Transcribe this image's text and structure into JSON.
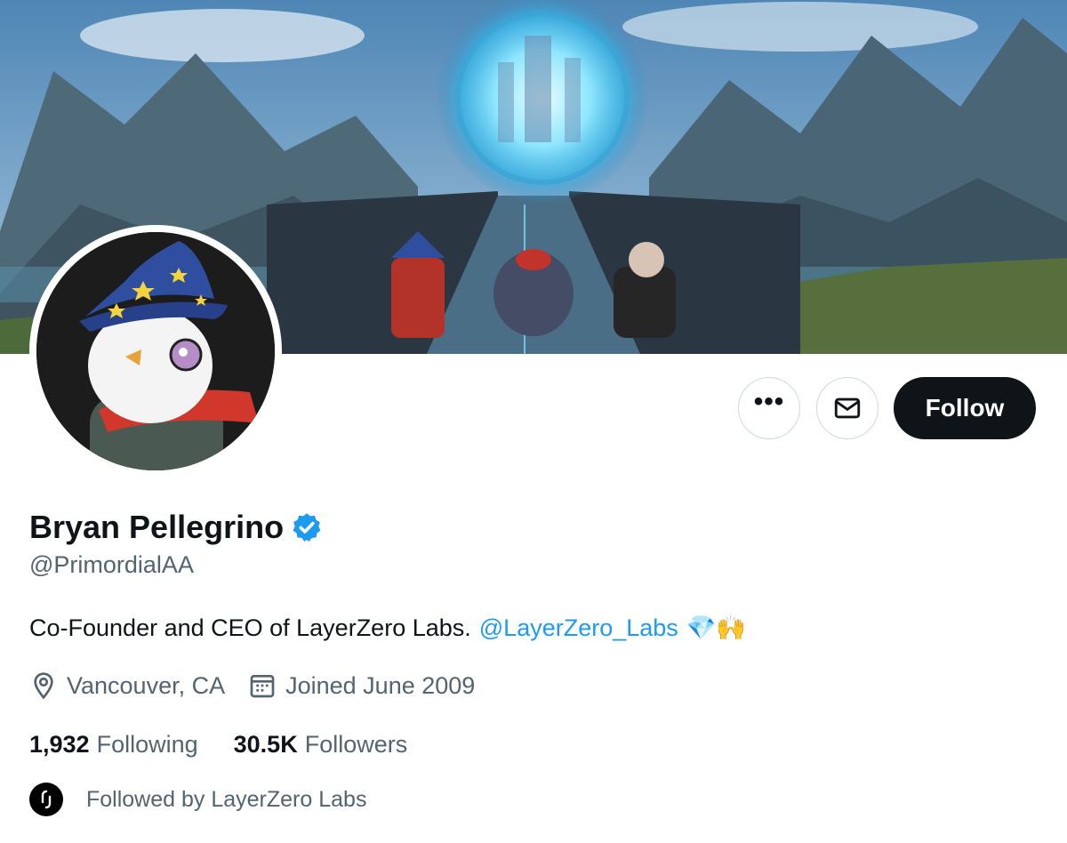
{
  "profile": {
    "display_name": "Bryan Pellegrino",
    "handle": "@PrimordialAA",
    "verified": true,
    "bio_text": "Co-Founder and CEO of LayerZero Labs.",
    "bio_mention": "@LayerZero_Labs",
    "bio_emoji": "💎🙌",
    "location": "Vancouver, CA",
    "joined": "Joined June 2009"
  },
  "stats": {
    "following_count": "1,932",
    "following_label": "Following",
    "followers_count": "30.5K",
    "followers_label": "Followers"
  },
  "followed_by": {
    "text": "Followed by LayerZero Labs"
  },
  "actions": {
    "follow_label": "Follow",
    "more_label": "•••"
  },
  "icons": {
    "more": "more-icon",
    "message": "envelope-icon",
    "location": "location-pin-icon",
    "calendar": "calendar-icon",
    "verified": "verified-badge-icon"
  },
  "colors": {
    "accent": "#1d9bf0",
    "text_primary": "#0f1419",
    "text_secondary": "#536471",
    "button_dark": "#0f1419"
  }
}
